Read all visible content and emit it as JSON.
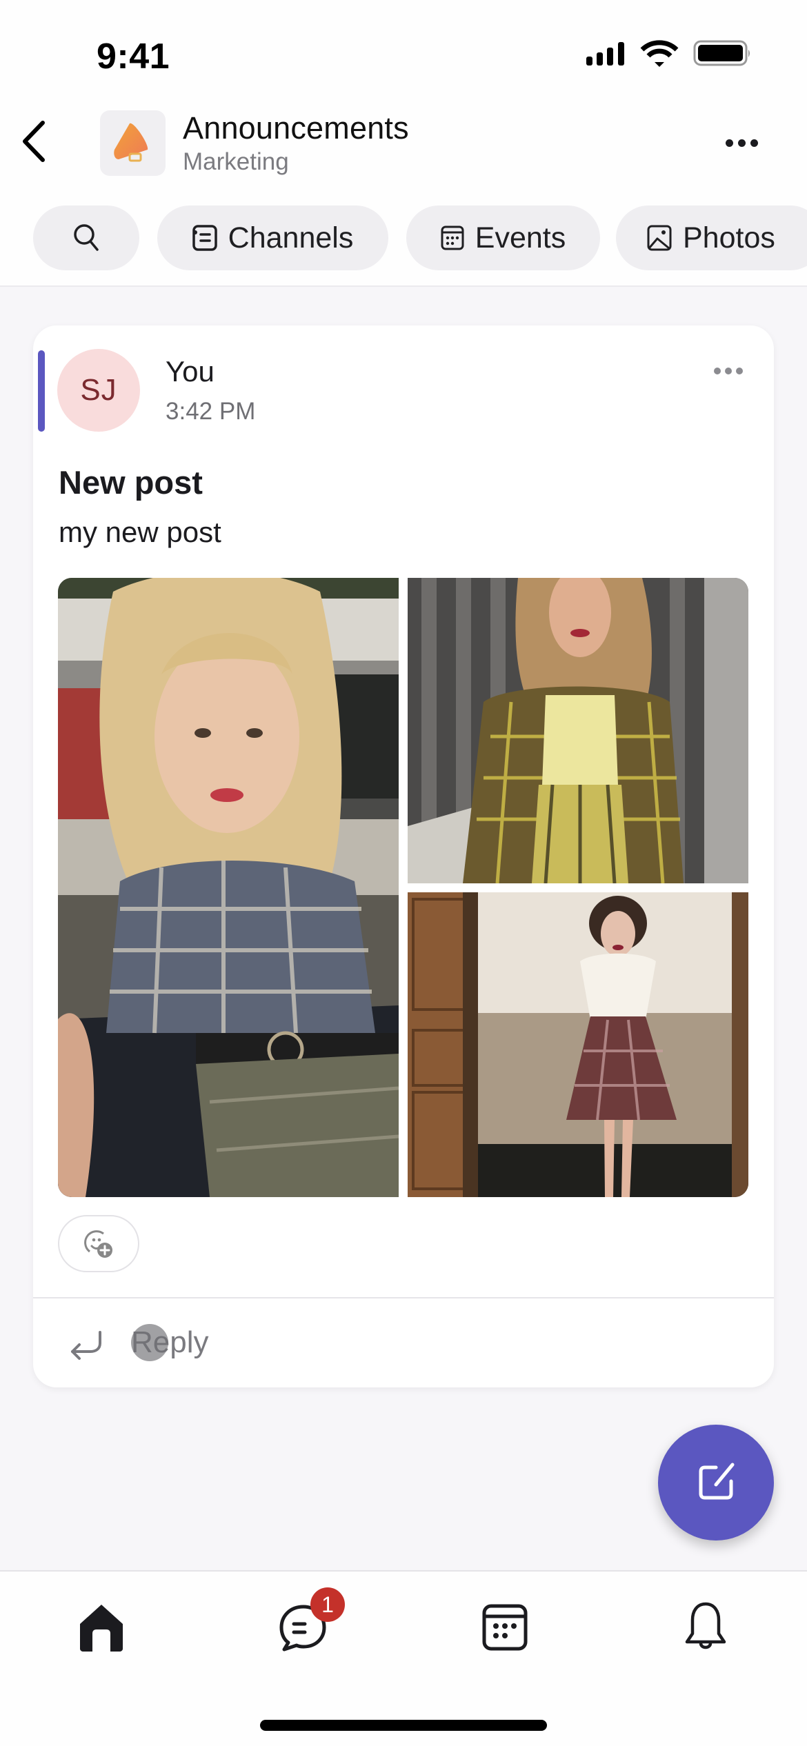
{
  "status_bar": {
    "time": "9:41",
    "icons": [
      "cellular-signal-icon",
      "wifi-icon",
      "battery-icon"
    ]
  },
  "header": {
    "back_icon": "chevron-left-icon",
    "channel_icon": "megaphone-icon",
    "title": "Announcements",
    "subtitle": "Marketing",
    "more_icon": "more-horizontal-icon"
  },
  "filter_pills": [
    {
      "label": "",
      "icon": "search-icon"
    },
    {
      "label": "Channels",
      "icon": "channels-list-icon"
    },
    {
      "label": "Events",
      "icon": "calendar-icon"
    },
    {
      "label": "Photos",
      "icon": "image-icon"
    }
  ],
  "post": {
    "avatar_initials": "SJ",
    "author": "You",
    "time": "3:42 PM",
    "title": "New post",
    "body": "my new post",
    "photos": [
      {
        "description": "blonde woman in plaid crop shirt and belted skirt"
      },
      {
        "description": "woman in yellow plaid blazer and trousers"
      },
      {
        "description": "woman in white blouse and maroon plaid skirt"
      }
    ],
    "reaction_icon": "add-reaction-icon",
    "reply_label": "Reply",
    "accent_color": "#5b57c0",
    "avatar_bg": "#f9dcdc",
    "avatar_fg": "#7b2a2f"
  },
  "fab": {
    "icon": "compose-icon",
    "color": "#5b57c0"
  },
  "bottom_nav": {
    "items": [
      {
        "name": "home",
        "icon": "home-icon",
        "active": true
      },
      {
        "name": "chats",
        "icon": "chat-icon",
        "badge": "1"
      },
      {
        "name": "calendar",
        "icon": "calendar-icon"
      },
      {
        "name": "notifications",
        "icon": "bell-icon"
      }
    ],
    "badge_color": "#c4312a"
  }
}
